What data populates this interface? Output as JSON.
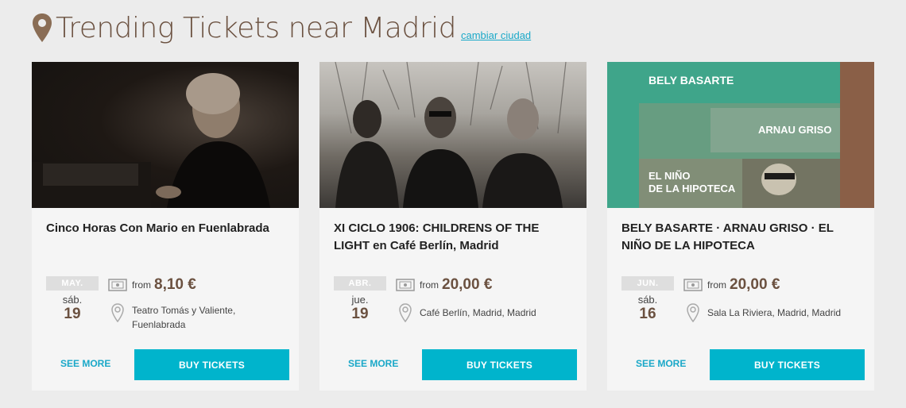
{
  "header": {
    "title": "Trending Tickets near Madrid",
    "change_city": "cambiar ciudad"
  },
  "colors": {
    "accent": "#00b4cc",
    "link": "#1aa8c8",
    "brown": "#6b5140"
  },
  "cards": [
    {
      "title": "Cinco Horas Con Mario en Fuenlabrada",
      "month": "MAY.",
      "weekday": "sáb.",
      "day": "19",
      "from_label": "from",
      "price": "8,10 €",
      "venue": "Teatro Tomás y Valiente, Fuenlabrada",
      "see_more": "SEE MORE",
      "buy": "BUY TICKETS"
    },
    {
      "title": "XI CICLO 1906: CHILDRENS OF THE LIGHT en Café Berlín, Madrid",
      "month": "ABR.",
      "weekday": "jue.",
      "day": "19",
      "from_label": "from",
      "price": "20,00 €",
      "venue": "Café Berlín, Madrid, Madrid",
      "see_more": "SEE MORE",
      "buy": "BUY TICKETS"
    },
    {
      "title": "BELY BASARTE · ARNAU GRISO · EL NIÑO DE LA HIPOTECA",
      "month": "JUN.",
      "weekday": "sáb.",
      "day": "16",
      "from_label": "from",
      "price": "20,00 €",
      "venue": "Sala La Riviera, Madrid, Madrid",
      "see_more": "SEE MORE",
      "buy": "BUY TICKETS",
      "poster": {
        "line1": "BELY BASARTE",
        "line2": "ARNAU GRISO",
        "line3": "EL NIÑO",
        "line4": "DE LA HIPOTECA"
      }
    }
  ]
}
